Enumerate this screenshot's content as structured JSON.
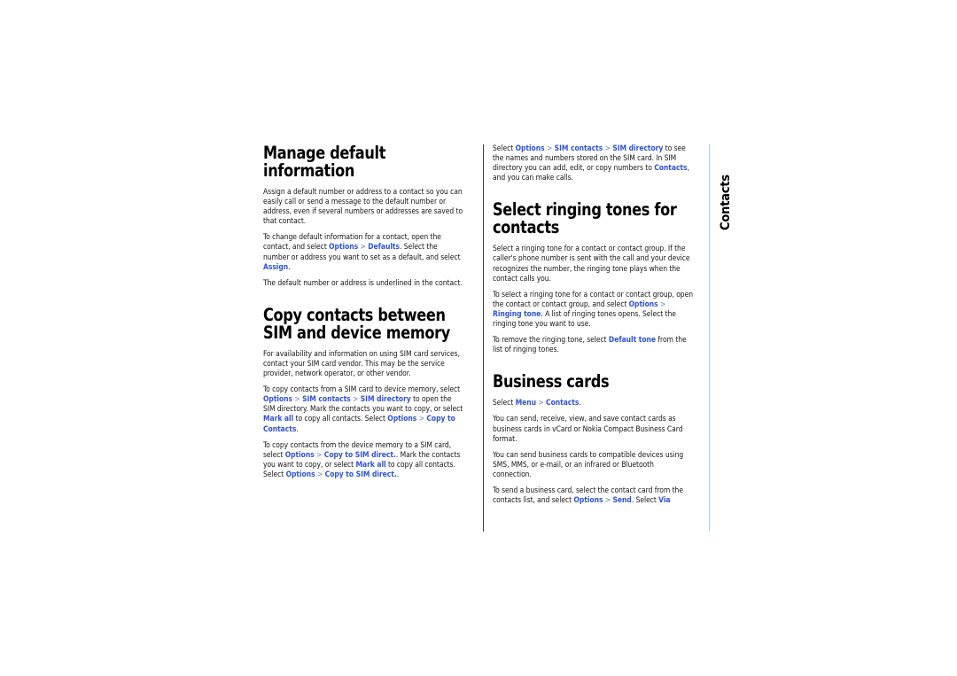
{
  "page": {
    "chapter_tab_label": "Contacts",
    "link_color": "#2f53d8",
    "separator_color": "#6d80c4",
    "center_rule_color": "#3a3f46",
    "right_rule_color": "#a9cdf2",
    "background_color": "#ffffff",
    "text_color": "#141414"
  },
  "left_column": {
    "section1": {
      "heading": "Manage default information",
      "paragraphs": [
        {
          "id": "p1",
          "runs": [
            {
              "text": "Assign a default number or address to a contact so you can easily call or send a message to the default number or address, even if several numbers or addresses are saved to that contact.",
              "style": "plain"
            }
          ]
        },
        {
          "id": "p2",
          "runs": [
            {
              "text": "To change default information for a contact, open the contact, and select ",
              "style": "plain"
            },
            {
              "text": "Options",
              "style": "link"
            },
            {
              "text": " > ",
              "style": "sep"
            },
            {
              "text": "Defaults",
              "style": "link"
            },
            {
              "text": ". Select the number or address you want to set as a default, and select ",
              "style": "plain"
            },
            {
              "text": "Assign",
              "style": "link"
            },
            {
              "text": ".",
              "style": "plain"
            }
          ]
        },
        {
          "id": "p3",
          "runs": [
            {
              "text": "The default number or address is underlined in the contact.",
              "style": "plain"
            }
          ]
        }
      ]
    },
    "section2": {
      "heading": "Copy contacts between SIM and device memory",
      "paragraphs": [
        {
          "id": "p1",
          "runs": [
            {
              "text": "For availability and information on using SIM card services, contact your SIM card vendor. This may be the service provider, network operator, or other vendor.",
              "style": "plain"
            }
          ]
        },
        {
          "id": "p2",
          "runs": [
            {
              "text": "To copy contacts from a SIM card to device memory, select ",
              "style": "plain"
            },
            {
              "text": "Options",
              "style": "link"
            },
            {
              "text": " > ",
              "style": "sep"
            },
            {
              "text": "SIM contacts",
              "style": "link"
            },
            {
              "text": " > ",
              "style": "sep"
            },
            {
              "text": "SIM directory",
              "style": "link"
            },
            {
              "text": " to open the SIM directory. Mark the contacts you want to copy, or select ",
              "style": "plain"
            },
            {
              "text": "Mark all",
              "style": "link"
            },
            {
              "text": " to copy all contacts. Select ",
              "style": "plain"
            },
            {
              "text": "Options",
              "style": "link"
            },
            {
              "text": " > ",
              "style": "sep"
            },
            {
              "text": "Copy to Contacts",
              "style": "link"
            },
            {
              "text": ".",
              "style": "plain"
            }
          ]
        },
        {
          "id": "p3",
          "runs": [
            {
              "text": "To copy contacts from the device memory to a SIM card, select ",
              "style": "plain"
            },
            {
              "text": "Options",
              "style": "link"
            },
            {
              "text": " > ",
              "style": "sep"
            },
            {
              "text": "Copy to SIM direct.",
              "style": "link"
            },
            {
              "text": ". Mark the contacts you want to copy, or select ",
              "style": "plain"
            },
            {
              "text": "Mark all",
              "style": "link"
            },
            {
              "text": " to copy all contacts. Select ",
              "style": "plain"
            },
            {
              "text": "Options",
              "style": "link"
            },
            {
              "text": " > ",
              "style": "sep"
            },
            {
              "text": "Copy to SIM direct.",
              "style": "link"
            },
            {
              "text": ".",
              "style": "plain"
            }
          ]
        }
      ]
    }
  },
  "right_column": {
    "section0": {
      "paragraphs": [
        {
          "id": "p1",
          "runs": [
            {
              "text": "Select ",
              "style": "plain"
            },
            {
              "text": "Options",
              "style": "link"
            },
            {
              "text": " > ",
              "style": "sep"
            },
            {
              "text": "SIM contacts",
              "style": "link"
            },
            {
              "text": " > ",
              "style": "sep"
            },
            {
              "text": "SIM directory",
              "style": "link"
            },
            {
              "text": " to see the names and numbers stored on the SIM card. In SIM directory you can add, edit, or copy numbers to ",
              "style": "plain"
            },
            {
              "text": "Contacts",
              "style": "link"
            },
            {
              "text": ", and you can make calls.",
              "style": "plain"
            }
          ]
        }
      ]
    },
    "section1": {
      "heading": "Select ringing tones for contacts",
      "paragraphs": [
        {
          "id": "p1",
          "runs": [
            {
              "text": "Select a ringing tone for a contact or contact group. If the caller's phone number is sent with the call and your device recognizes the number, the ringing tone plays when the contact calls you.",
              "style": "plain"
            }
          ]
        },
        {
          "id": "p2",
          "runs": [
            {
              "text": "To select a ringing tone for a contact or contact group, open the contact or contact group, and select ",
              "style": "plain"
            },
            {
              "text": "Options",
              "style": "link"
            },
            {
              "text": " > ",
              "style": "sep"
            },
            {
              "text": "Ringing tone",
              "style": "link"
            },
            {
              "text": ". A list of ringing tones opens. Select the ringing tone you want to use.",
              "style": "plain"
            }
          ]
        },
        {
          "id": "p3",
          "runs": [
            {
              "text": "To remove the ringing tone, select ",
              "style": "plain"
            },
            {
              "text": "Default tone",
              "style": "link"
            },
            {
              "text": " from the list of ringing tones.",
              "style": "plain"
            }
          ]
        }
      ]
    },
    "section2": {
      "heading": "Business cards",
      "paragraphs": [
        {
          "id": "p1",
          "runs": [
            {
              "text": "Select ",
              "style": "plain"
            },
            {
              "text": "Menu",
              "style": "link"
            },
            {
              "text": " > ",
              "style": "sep"
            },
            {
              "text": "Contacts",
              "style": "link"
            },
            {
              "text": ".",
              "style": "plain"
            }
          ]
        },
        {
          "id": "p2",
          "runs": [
            {
              "text": "You can send, receive, view, and save contact cards as business cards in vCard or Nokia Compact Business Card format.",
              "style": "plain"
            }
          ]
        },
        {
          "id": "p3",
          "runs": [
            {
              "text": "You can send business cards to compatible devices using SMS, MMS, or e-mail, or an infrared or Bluetooth connection.",
              "style": "plain"
            }
          ]
        },
        {
          "id": "p4",
          "runs": [
            {
              "text": "To send a business card, select the contact card from the contacts list, and select ",
              "style": "plain"
            },
            {
              "text": "Options",
              "style": "link"
            },
            {
              "text": " > ",
              "style": "sep"
            },
            {
              "text": "Send",
              "style": "link"
            },
            {
              "text": ". Select ",
              "style": "plain"
            },
            {
              "text": "Via",
              "style": "link"
            }
          ]
        }
      ]
    }
  }
}
